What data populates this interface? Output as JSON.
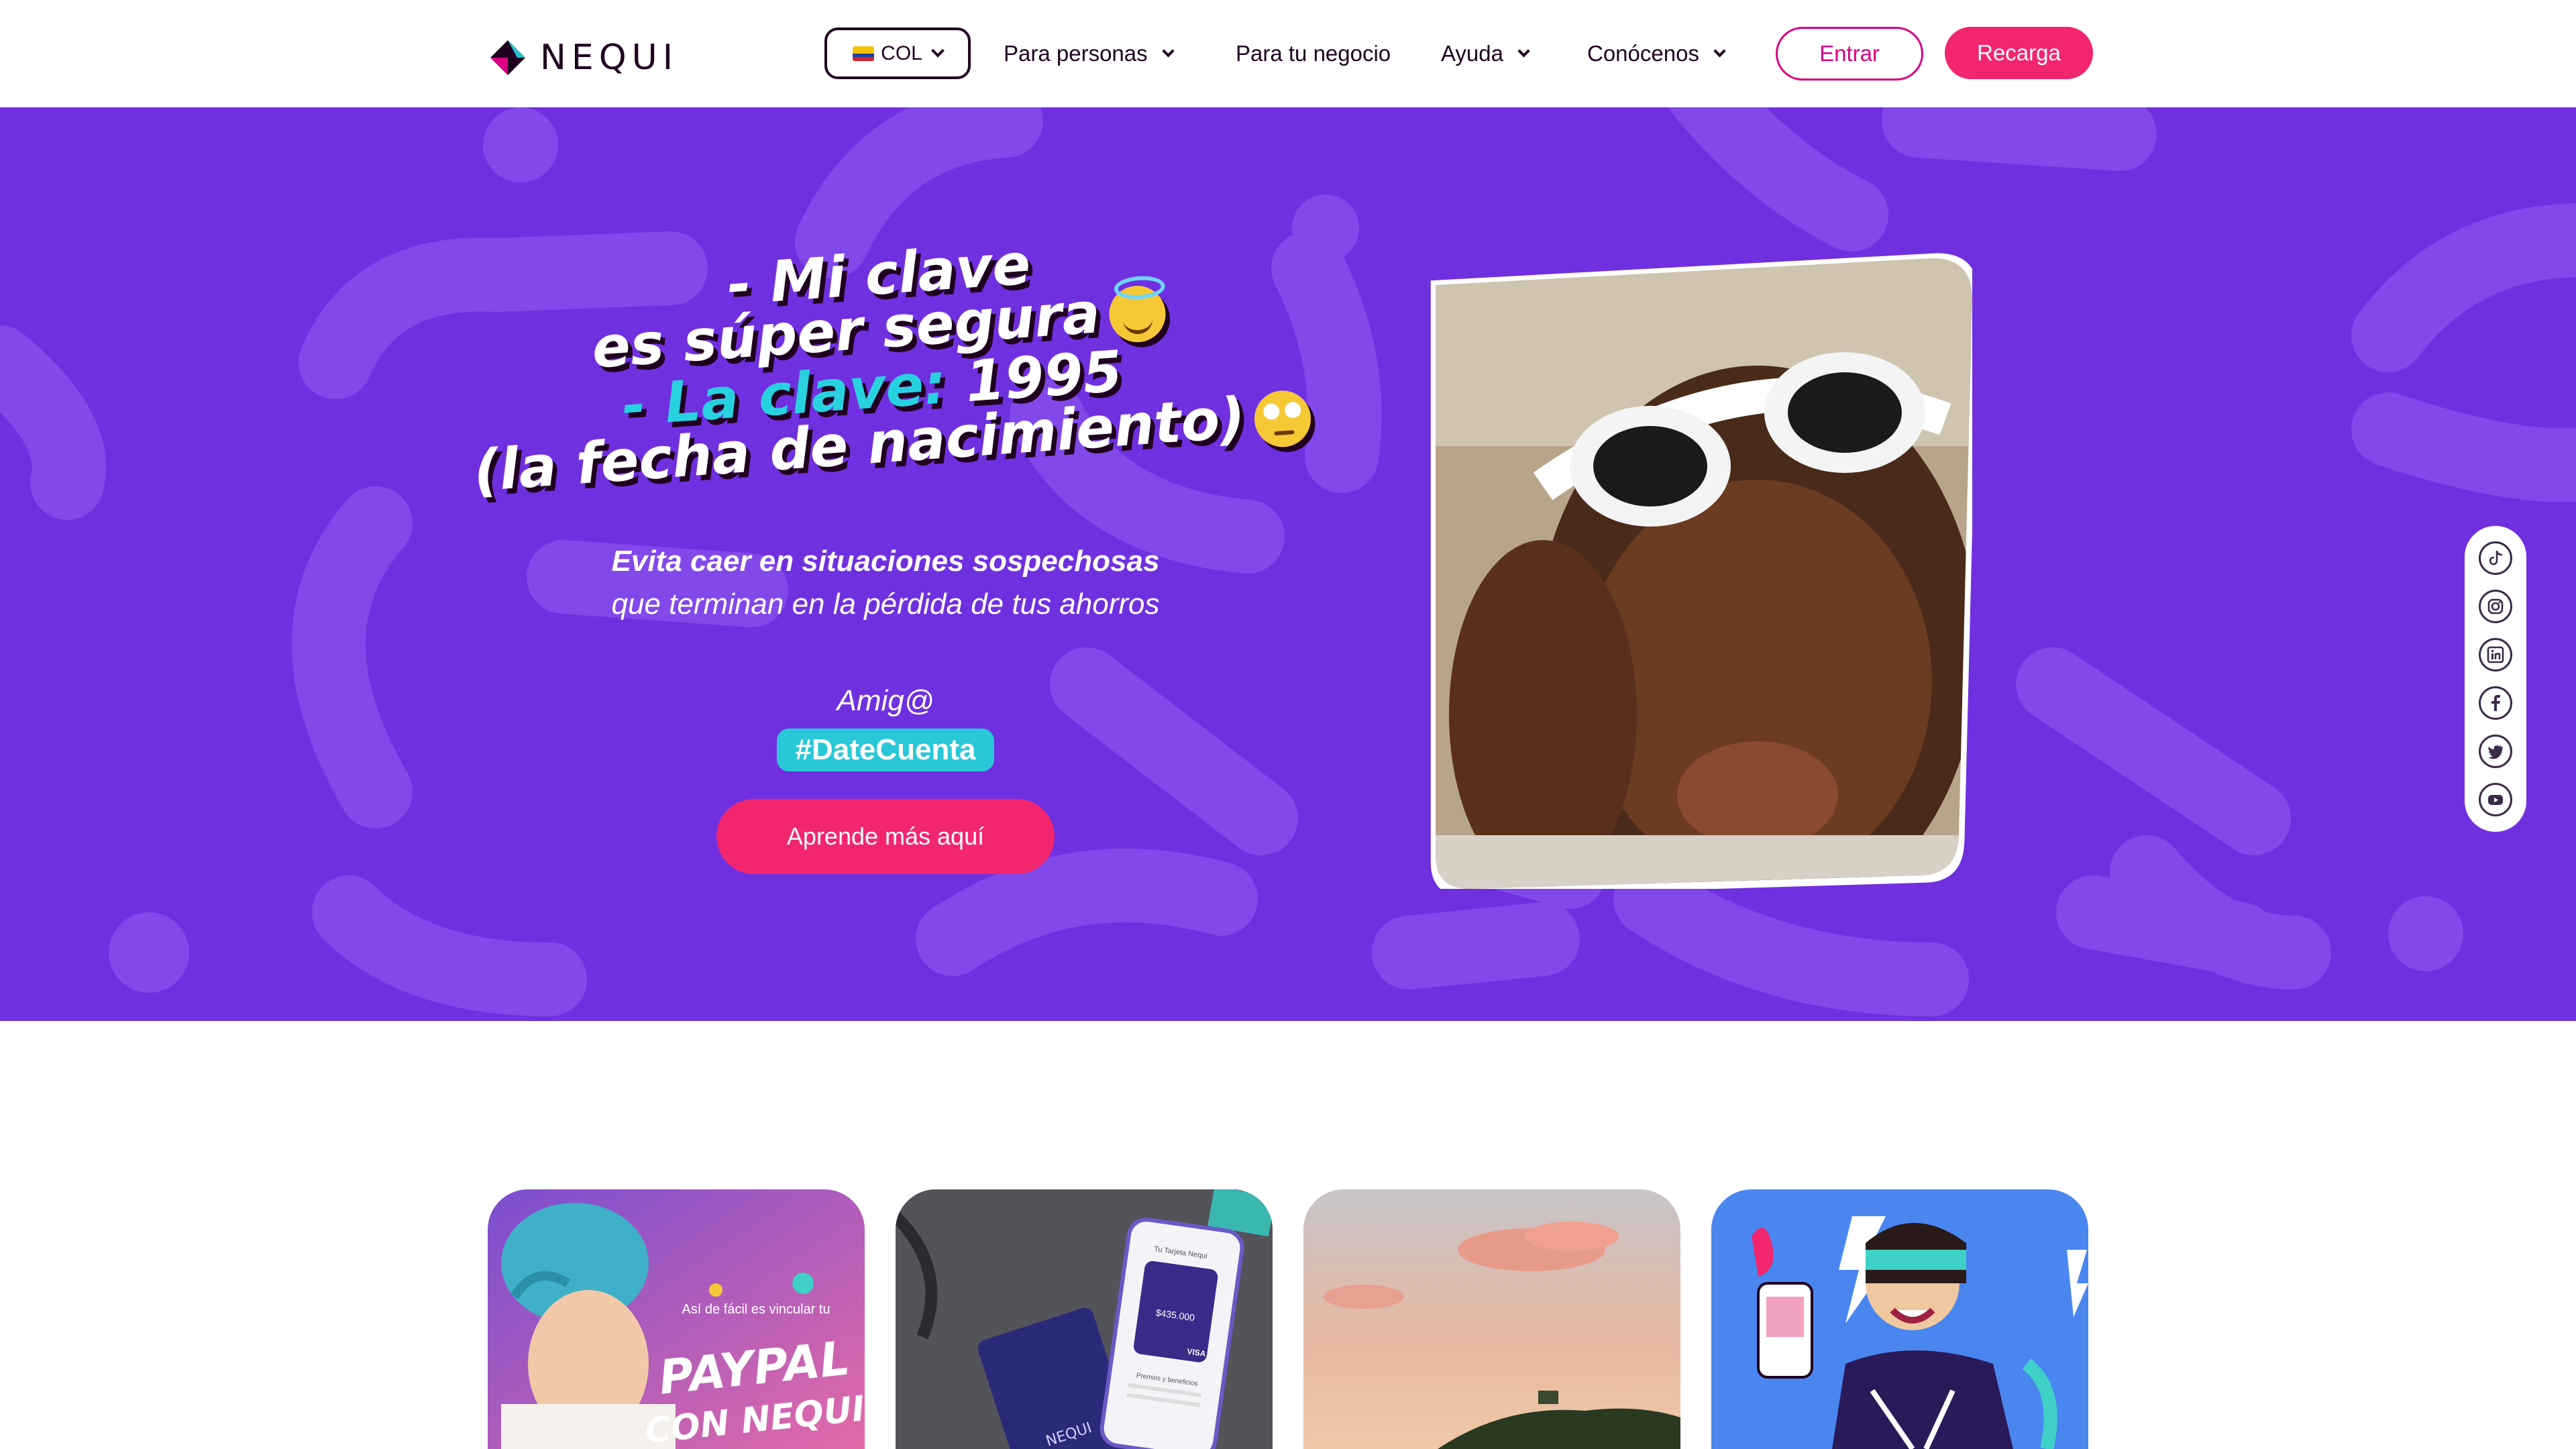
{
  "header": {
    "logo_text": "NEQUI",
    "country": {
      "code": "COL",
      "flag": "colombia-flag"
    },
    "nav": [
      {
        "label": "Para personas",
        "has_dropdown": true
      },
      {
        "label": "Para tu negocio",
        "has_dropdown": false
      },
      {
        "label": "Ayuda",
        "has_dropdown": true
      },
      {
        "label": "Conócenos",
        "has_dropdown": true
      }
    ],
    "login_label": "Entrar",
    "recharge_label": "Recarga"
  },
  "hero": {
    "headline": {
      "line1": "- Mi clave",
      "line2": "es súper segura",
      "line3_highlight": "- La clave:",
      "line3_rest": " 1995",
      "line4": "(la fecha de nacimiento)"
    },
    "emojis": [
      "smiling-face-with-halo",
      "face-with-rolling-eyes"
    ],
    "subtitle": {
      "bold": "Evita caer en situaciones sospechosas",
      "rest": " que terminan en la pérdida de tus ahorros"
    },
    "amig": "Amig@",
    "hashtag": "#DateCuenta",
    "cta_label": "Aprende más aquí"
  },
  "social": [
    "tiktok-icon",
    "instagram-icon",
    "linkedin-icon",
    "facebook-icon",
    "twitter-icon",
    "youtube-icon"
  ],
  "cards": [
    {
      "caption_small": "Así de fácil es vincular tu",
      "caption_big": "PAYPAL",
      "caption_sub": "CON NEQUI."
    },
    {
      "phone_label": "Tu Tarjeta Nequi",
      "amount": "$435.000",
      "card_brand": "VISA",
      "card_logo": "NEQUI",
      "menu_label": "Premios y beneficios"
    },
    {
      "scene": "sunset-landscape"
    },
    {
      "scene": "woman-with-phone"
    }
  ],
  "colors": {
    "brand_purple": "#7030e0",
    "brand_pink": "#f2266f",
    "brand_magenta": "#da0081",
    "brand_teal": "#28d1e0",
    "text_dark": "#200020"
  }
}
